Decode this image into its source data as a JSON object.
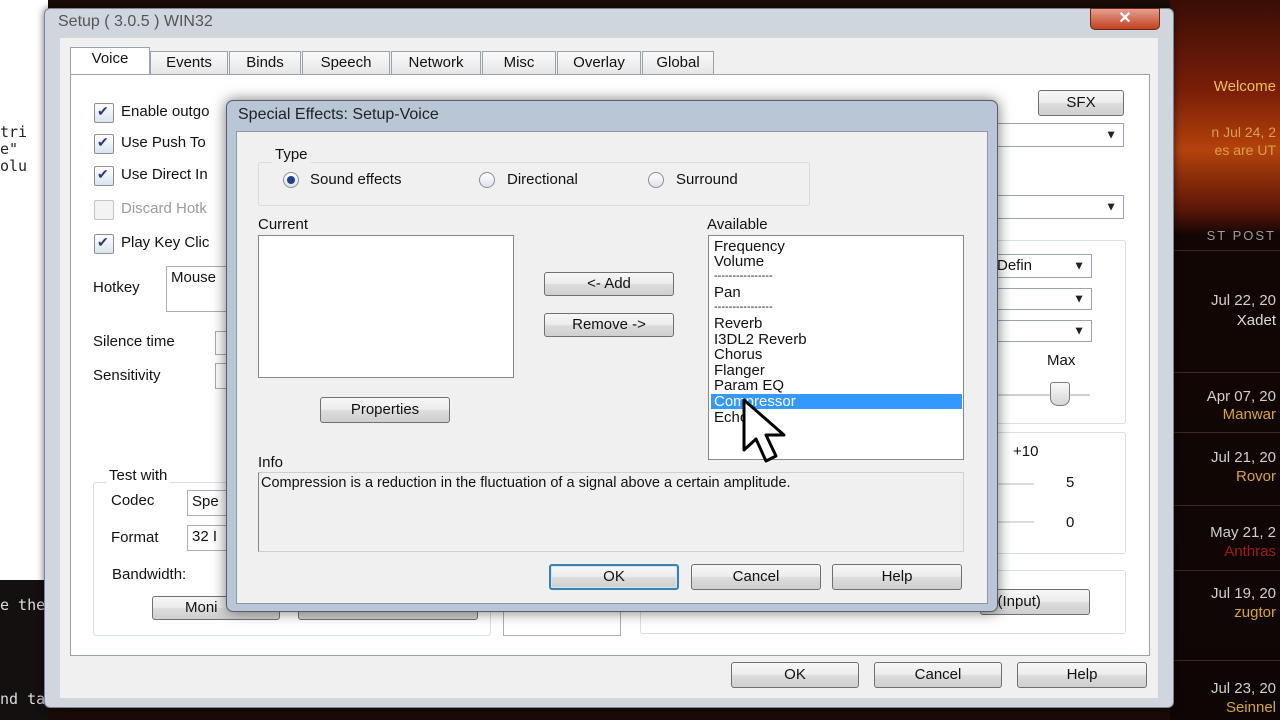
{
  "background": {
    "left_code": [
      "tri",
      "e\"",
      "olu"
    ],
    "left_bottom": [
      "e the",
      "nd ta"
    ],
    "forum": {
      "welcome": "Welcome",
      "date_line": "n Jul 24, 2",
      "names_line": "es are UT",
      "header": "ST POST",
      "posts": [
        {
          "date": "Jul 22, 20",
          "user": "Xadet"
        },
        {
          "date": "Apr 07, 20",
          "user": "Manwar"
        },
        {
          "date": "Jul 21, 20",
          "user": "Rovor"
        },
        {
          "date": "May 21, 2",
          "user": "Anthras"
        },
        {
          "date": "Jul 19, 20",
          "user": "zugtor"
        },
        {
          "date": "Jul 23, 20",
          "user": "Seinnel"
        }
      ]
    }
  },
  "setup": {
    "title": "Setup ( 3.0.5 ) WIN32",
    "close": "✕",
    "tabs": [
      "Voice",
      "Events",
      "Binds",
      "Speech",
      "Network",
      "Misc",
      "Overlay",
      "Global"
    ],
    "checkboxes": [
      {
        "label": "Enable outgo",
        "checked": true,
        "enabled": true
      },
      {
        "label": "Use Push To",
        "checked": true,
        "enabled": true
      },
      {
        "label": "Use Direct In",
        "checked": true,
        "enabled": true
      },
      {
        "label": "Discard Hotk",
        "checked": false,
        "enabled": false
      },
      {
        "label": "Play Key Clic",
        "checked": true,
        "enabled": true
      }
    ],
    "hotkey_label": "Hotkey",
    "hotkey_value": "Mouse",
    "silence_label": "Silence time",
    "sensitivity_label": "Sensitivity",
    "sfx_button": "SFX",
    "defin_combo": "Defin",
    "max_label": "Max",
    "plus10_label": "+10",
    "val5": "5",
    "val0": "0",
    "test_with": "Test with",
    "codec_label": "Codec",
    "codec_value": "Spe",
    "format_label": "Format",
    "format_value": "32 I",
    "bandwidth_label": "Bandwidth:",
    "moni_button": "Moni",
    "input_button": "g (Input)",
    "ok": "OK",
    "cancel": "Cancel",
    "help": "Help"
  },
  "dialog": {
    "title": "Special Effects: Setup-Voice",
    "type_label": "Type",
    "radios": [
      {
        "label": "Sound effects",
        "on": true
      },
      {
        "label": "Directional",
        "on": false
      },
      {
        "label": "Surround",
        "on": false
      }
    ],
    "current_label": "Current",
    "available_label": "Available",
    "add_button": "<- Add",
    "remove_button": "Remove ->",
    "properties_button": "Properties",
    "available": [
      "Frequency",
      "Volume",
      "----------------",
      "Pan",
      "----------------",
      "Reverb",
      "I3DL2 Reverb",
      "Chorus",
      "Flanger",
      "Param EQ",
      "Compressor",
      "Echo"
    ],
    "selected_index": 10,
    "info_label": "Info",
    "info_text": "Compression is a reduction in the fluctuation of a signal above a certain amplitude.",
    "ok": "OK",
    "cancel": "Cancel",
    "help": "Help"
  }
}
